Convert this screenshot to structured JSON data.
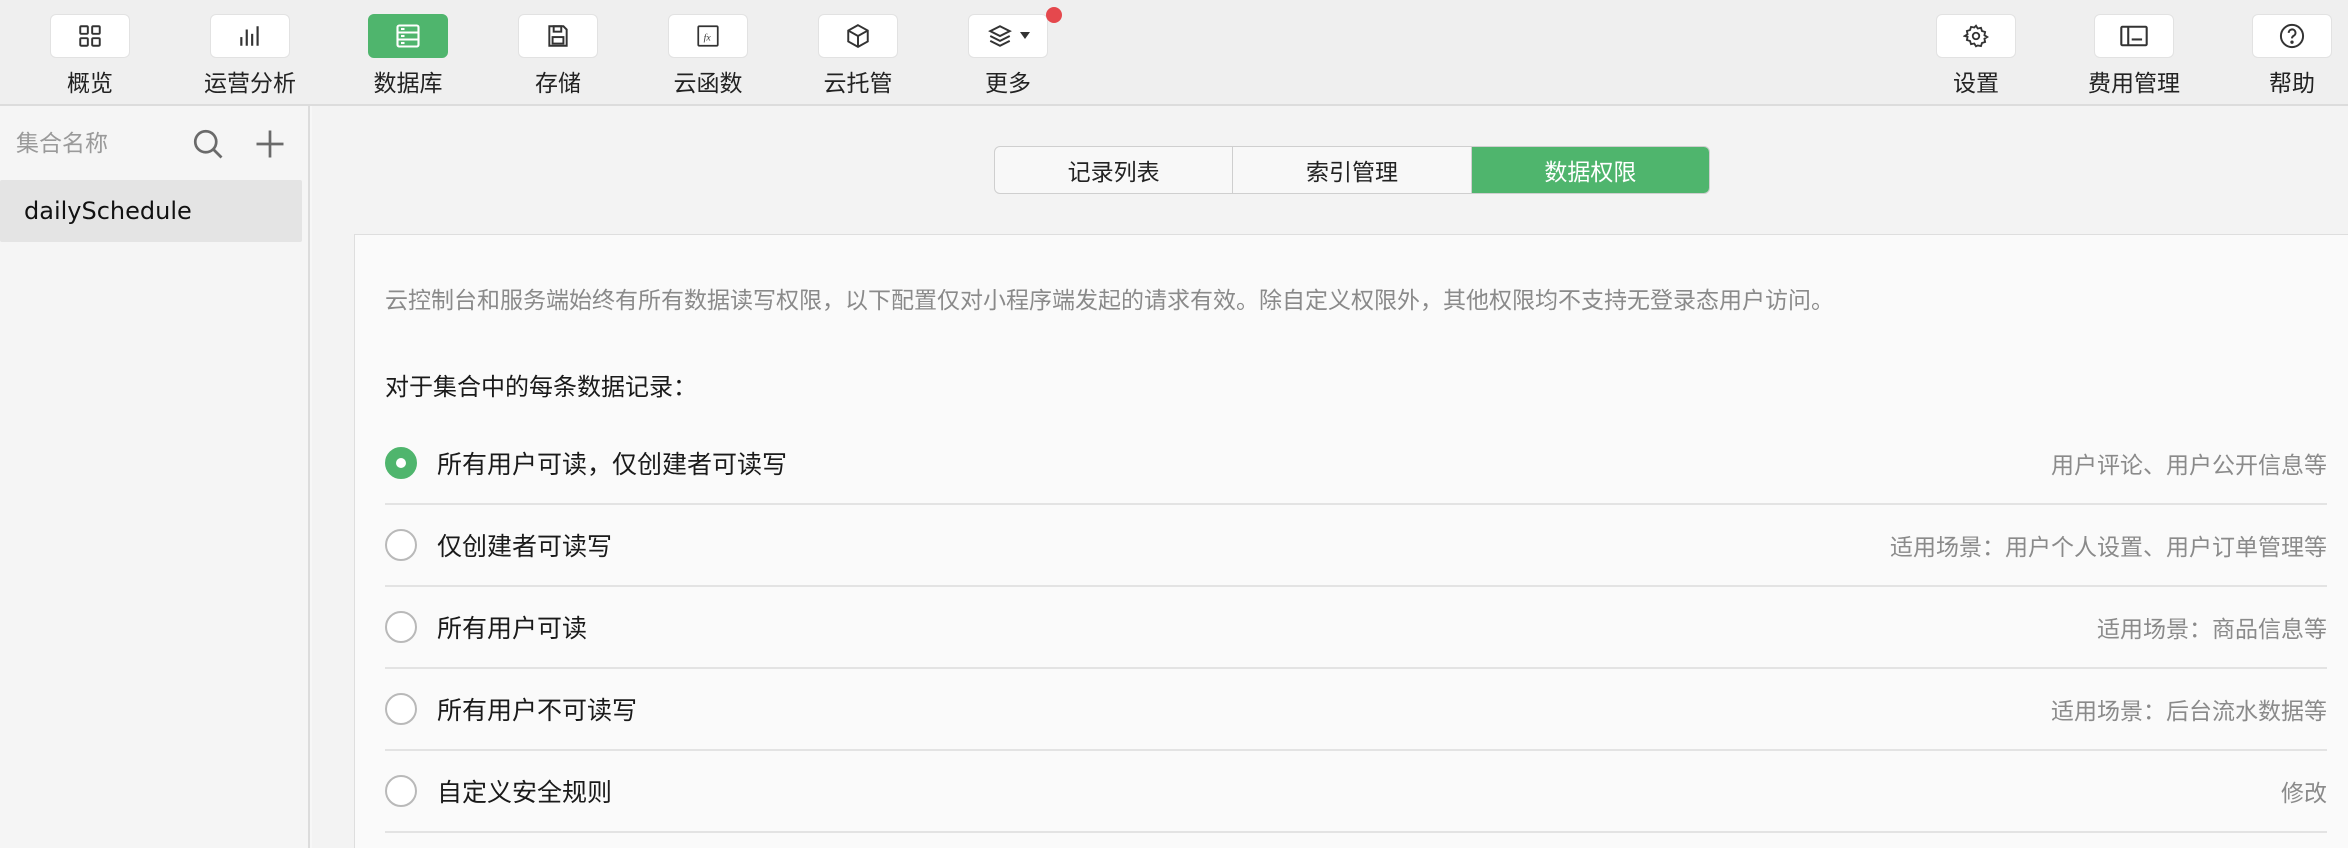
{
  "toolbar": {
    "items": [
      {
        "label": "概览",
        "icon": "grid-icon",
        "active": false
      },
      {
        "label": "运营分析",
        "icon": "bar-chart-icon",
        "active": false
      },
      {
        "label": "数据库",
        "icon": "database-icon",
        "active": true
      },
      {
        "label": "存储",
        "icon": "save-disk-icon",
        "active": false
      },
      {
        "label": "云函数",
        "icon": "function-icon",
        "active": false
      },
      {
        "label": "云托管",
        "icon": "cube-icon",
        "active": false
      },
      {
        "label": "更多",
        "icon": "layers-icon",
        "active": false,
        "has_notification": true
      }
    ],
    "right_items": [
      {
        "label": "设置",
        "icon": "gear-icon"
      },
      {
        "label": "费用管理",
        "icon": "card-icon"
      },
      {
        "label": "帮助",
        "icon": "help-circle-icon"
      }
    ]
  },
  "sidebar": {
    "search_placeholder": "集合名称",
    "collections": [
      "dailySchedule"
    ]
  },
  "main": {
    "tabs": [
      {
        "label": "记录列表",
        "active": false
      },
      {
        "label": "索引管理",
        "active": false
      },
      {
        "label": "数据权限",
        "active": true
      }
    ],
    "notice": "云控制台和服务端始终有所有数据读写权限，以下配置仅对小程序端发起的请求有效。除自定义权限外，其他权限均不支持无登录态用户访问。",
    "subhead": "对于集合中的每条数据记录：",
    "options": [
      {
        "label": "所有用户可读，仅创建者可读写",
        "hint": "用户评论、用户公开信息等",
        "checked": true
      },
      {
        "label": "仅创建者可读写",
        "hint": "适用场景：用户个人设置、用户订单管理等",
        "checked": false
      },
      {
        "label": "所有用户可读",
        "hint": "适用场景：商品信息等",
        "checked": false
      },
      {
        "label": "所有用户不可读写",
        "hint": "适用场景：后台流水数据等",
        "checked": false
      },
      {
        "label": "自定义安全规则",
        "hint": "修改",
        "checked": false
      }
    ]
  },
  "colors": {
    "accent": "#4fb56d",
    "notification": "#e5484d"
  }
}
